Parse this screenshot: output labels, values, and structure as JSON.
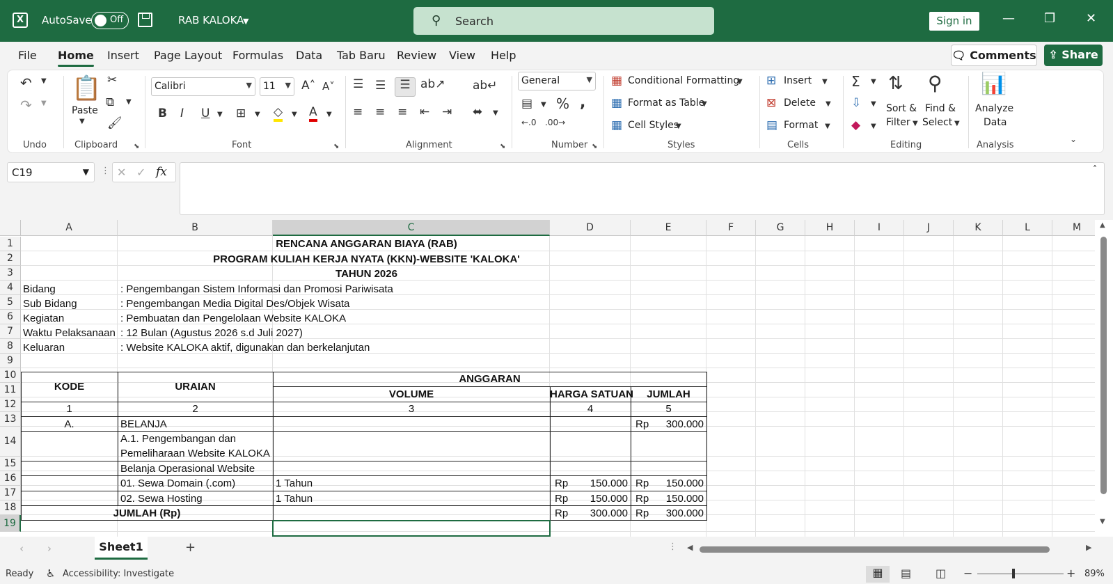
{
  "titlebar": {
    "autosave_label": "AutoSave",
    "autosave_state": "Off",
    "filename": "RAB KALOKA",
    "search_placeholder": "Search",
    "signin_label": "Sign in",
    "brand_color": "#1e6b41"
  },
  "menu": {
    "tabs": [
      "File",
      "Home",
      "Insert",
      "Page Layout",
      "Formulas",
      "Data",
      "Tab Baru",
      "Review",
      "View",
      "Help"
    ],
    "active_tab": "Home",
    "comments_label": "Comments",
    "share_label": "Share"
  },
  "ribbon": {
    "groups": {
      "undo": "Undo",
      "clipboard": "Clipboard",
      "font": "Font",
      "alignment": "Alignment",
      "number": "Number",
      "styles": "Styles",
      "cells": "Cells",
      "editing": "Editing",
      "analysis": "Analysis"
    },
    "paste_label": "Paste",
    "font_name": "Calibri",
    "font_size": "11",
    "number_format": "General",
    "conditional_formatting": "Conditional Formatting",
    "format_as_table": "Format as Table",
    "cell_styles": "Cell Styles",
    "insert": "Insert",
    "delete": "Delete",
    "format": "Format",
    "sort_filter_1": "Sort &",
    "sort_filter_2": "Filter",
    "find_select_1": "Find &",
    "find_select_2": "Select",
    "analyze_1": "Analyze",
    "analyze_2": "Data"
  },
  "formula_bar": {
    "name_box": "C19",
    "fx_label": "fx",
    "formula": ""
  },
  "grid": {
    "columns": [
      "A",
      "B",
      "C",
      "D",
      "E",
      "F",
      "G",
      "H",
      "I",
      "J",
      "K",
      "L",
      "M"
    ],
    "selected_column": "C",
    "rows": [
      "1",
      "2",
      "3",
      "4",
      "5",
      "6",
      "7",
      "8",
      "9",
      "10",
      "11",
      "12",
      "13",
      "14",
      "15",
      "16",
      "17",
      "18",
      "19"
    ],
    "selected_row": "19"
  },
  "sheet": {
    "title1": "RENCANA ANGGARAN BIAYA (RAB)",
    "title2": "PROGRAM KULIAH KERJA NYATA (KKN)-WEBSITE 'KALOKA'",
    "title3": "TAHUN 2026",
    "info": [
      {
        "label": "Bidang",
        "value": ": Pengembangan Sistem Informasi dan Promosi Pariwisata"
      },
      {
        "label": "Sub Bidang",
        "value": ": Pengembangan Media Digital Des/Objek Wisata"
      },
      {
        "label": "Kegiatan",
        "value": ": Pembuatan dan Pengelolaan Website KALOKA"
      },
      {
        "label": "Waktu Pelaksanaan",
        "value": ": 12 Bulan (Agustus 2026 s.d Juli 2027)"
      },
      {
        "label": "Keluaran",
        "value": ": Website KALOKA aktif, digunakan dan berkelanjutan"
      }
    ],
    "headers": {
      "kode": "KODE",
      "uraian": "URAIAN",
      "anggaran": "ANGGARAN",
      "volume": "VOLUME",
      "harga_satuan": "HARGA SATUAN",
      "jumlah": "JUMLAH"
    },
    "col_numbers": [
      "1",
      "2",
      "3",
      "4",
      "5"
    ],
    "rows": {
      "r13": {
        "kode": "A.",
        "uraian": "BELANJA",
        "jumlah_cur": "Rp",
        "jumlah": "300.000"
      },
      "r14": {
        "uraian_1": "A.1. Pengembangan dan",
        "uraian_2": "Pemeliharaan Website KALOKA"
      },
      "r15": {
        "uraian": "Belanja Operasional Website"
      },
      "r16": {
        "uraian": "01. Sewa Domain (.com)",
        "volume": "1 Tahun",
        "harga_cur": "Rp",
        "harga": "150.000",
        "jumlah_cur": "Rp",
        "jumlah": "150.000"
      },
      "r17": {
        "uraian": "02. Sewa Hosting",
        "volume": "1 Tahun",
        "harga_cur": "Rp",
        "harga": "150.000",
        "jumlah_cur": "Rp",
        "jumlah": "150.000"
      },
      "r18": {
        "label": "JUMLAH (Rp)",
        "harga_cur": "Rp",
        "harga": "300.000",
        "jumlah_cur": "Rp",
        "jumlah": "300.000"
      }
    }
  },
  "sheet_tabs": {
    "active": "Sheet1",
    "add_label": "+"
  },
  "status": {
    "ready": "Ready",
    "accessibility": "Accessibility: Investigate",
    "zoom": "89%"
  }
}
